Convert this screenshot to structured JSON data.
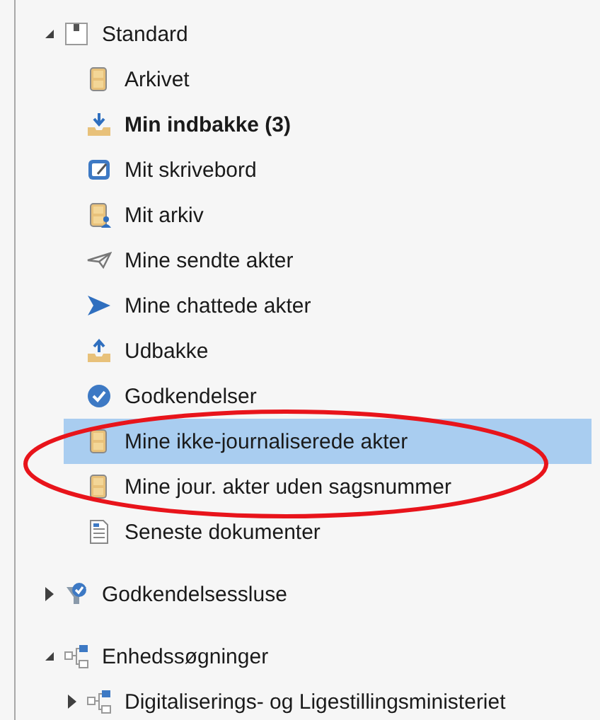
{
  "tree": [
    {
      "label": "Standard",
      "kind": "standard",
      "expanded": true,
      "selected": false,
      "bold": false,
      "children": [
        {
          "label": "Arkivet",
          "kind": "archive",
          "selected": false,
          "bold": false
        },
        {
          "label": "Min indbakke (3)",
          "kind": "inbox",
          "selected": false,
          "bold": true
        },
        {
          "label": "Mit skrivebord",
          "kind": "desk",
          "selected": false,
          "bold": false
        },
        {
          "label": "Mit arkiv",
          "kind": "my-archive",
          "selected": false,
          "bold": false
        },
        {
          "label": "Mine sendte akter",
          "kind": "sent",
          "selected": false,
          "bold": false
        },
        {
          "label": "Mine chattede akter",
          "kind": "chat",
          "selected": false,
          "bold": false
        },
        {
          "label": "Udbakke",
          "kind": "outbox",
          "selected": false,
          "bold": false
        },
        {
          "label": "Godkendelser",
          "kind": "approval",
          "selected": false,
          "bold": false
        },
        {
          "label": "Mine ikke-journaliserede akter",
          "kind": "archive",
          "selected": true,
          "bold": false
        },
        {
          "label": "Mine jour. akter uden sagsnummer",
          "kind": "archive",
          "selected": false,
          "bold": false
        },
        {
          "label": "Seneste dokumenter",
          "kind": "document",
          "selected": false,
          "bold": false
        }
      ]
    },
    {
      "label": "Godkendelsessluse",
      "kind": "approval-gate",
      "expanded": false,
      "selected": false,
      "bold": false
    },
    {
      "label": "Enhedssøgninger",
      "kind": "org",
      "expanded": true,
      "selected": false,
      "bold": false,
      "children": [
        {
          "label": "Digitaliserings- og Ligestillingsministeriet",
          "kind": "org",
          "expanded": false,
          "selected": false,
          "bold": false
        }
      ]
    }
  ],
  "annotation": {
    "kind": "ellipse"
  }
}
